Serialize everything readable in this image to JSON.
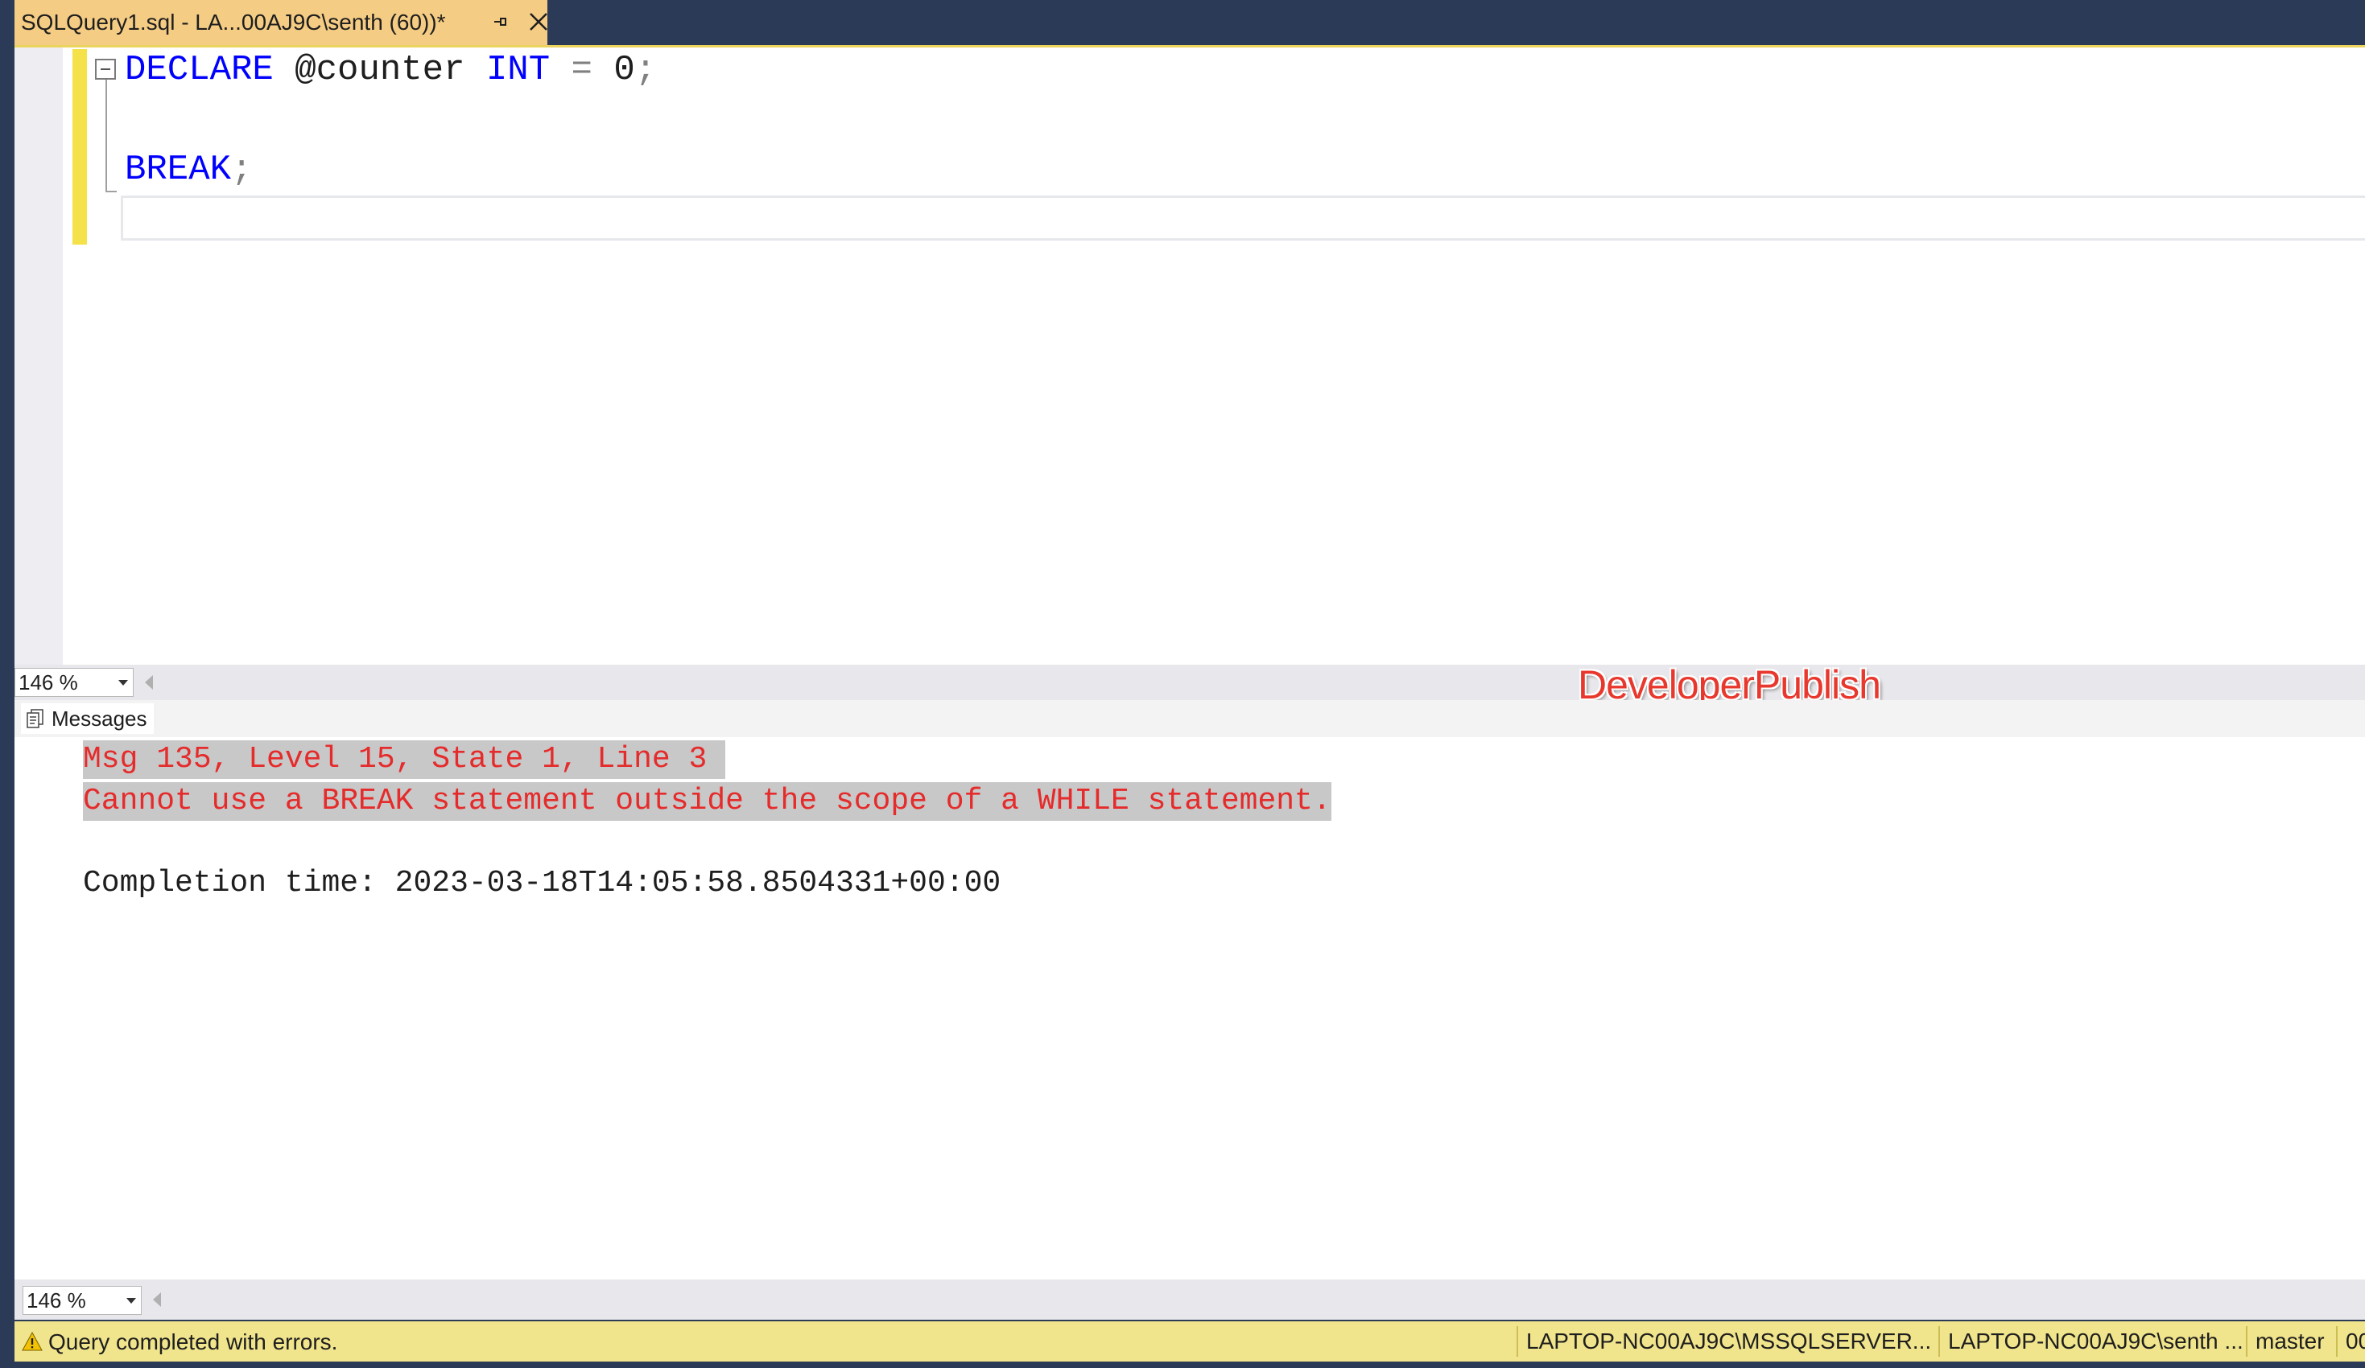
{
  "tab": {
    "title": "SQLQuery1.sql - LA...00AJ9C\\senth (60))*"
  },
  "editor": {
    "line1": {
      "kw1": "DECLARE",
      "var": "@counter",
      "kw2": "INT",
      "op": "=",
      "num": "0",
      "semi": ";"
    },
    "line3": {
      "kw": "BREAK",
      "semi": ";"
    },
    "zoom": "146 %"
  },
  "watermark": "DeveloperPublish",
  "results": {
    "tab_label": "Messages",
    "line1": "Msg 135, Level 15, State 1, Line 3 ",
    "line2": "Cannot use a BREAK statement outside the scope of a WHILE statement.",
    "completion": "Completion time: 2023-03-18T14:05:58.8504331+00:00",
    "zoom": "146 %"
  },
  "status": {
    "message": "Query completed with errors.",
    "server": "LAPTOP-NC00AJ9C\\MSSQLSERVER...",
    "user": "LAPTOP-NC00AJ9C\\senth ...",
    "database": "master",
    "time": "00"
  },
  "colors": {
    "keyword": "#0000ff",
    "error": "#e52b2b",
    "status_bar": "#f0e48c",
    "tab": "#f5cc84",
    "chrome": "#2b3a56"
  }
}
